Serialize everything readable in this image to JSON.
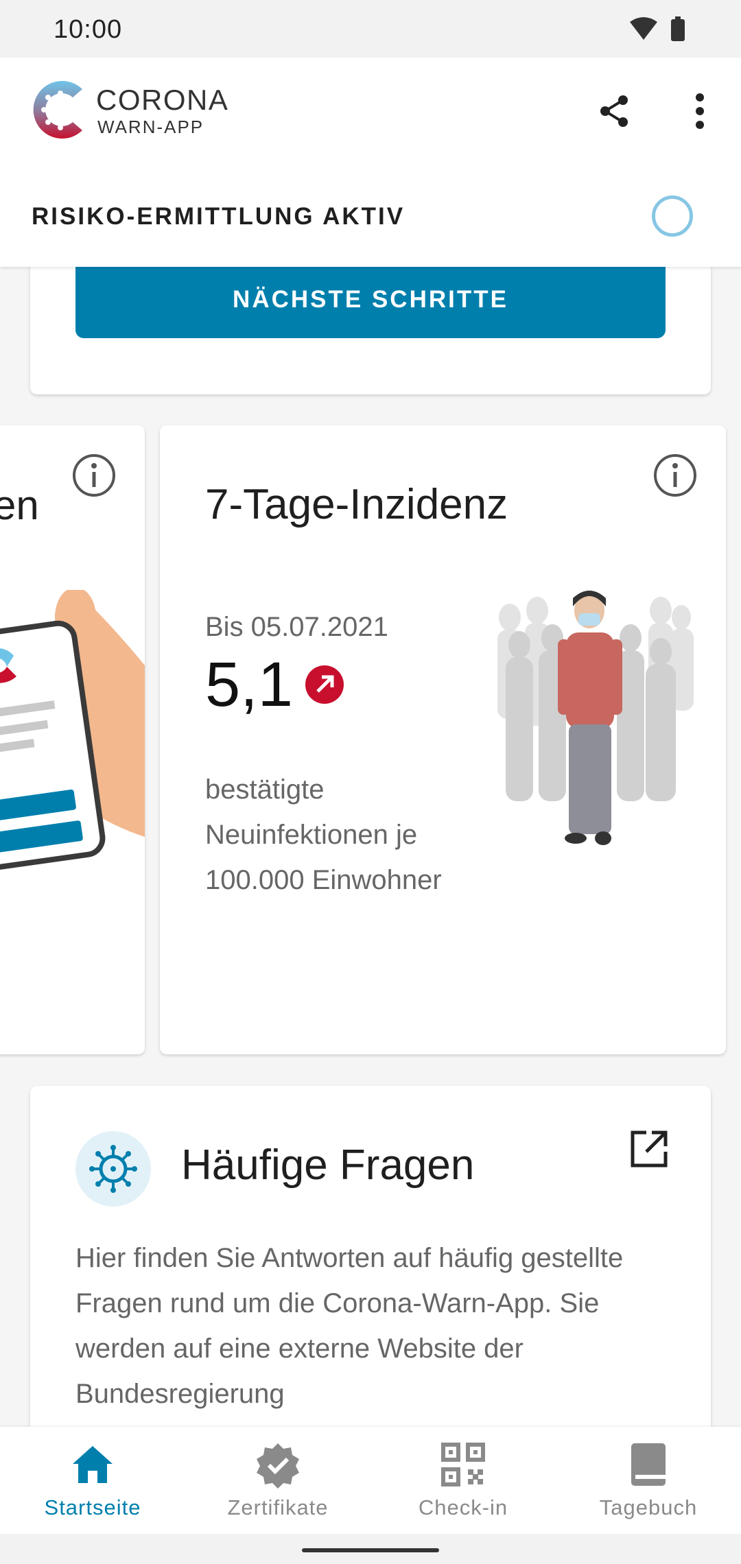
{
  "status_bar": {
    "time": "10:00"
  },
  "header": {
    "brand_main": "CORONA",
    "brand_sub": "WARN-APP",
    "risk_label": "RISIKO-ERMITTLUNG AKTIV"
  },
  "top_card": {
    "button_label": "NÄCHSTE SCHRITTE"
  },
  "left_card": {
    "partial_text": "en"
  },
  "incidence_card": {
    "title": "7-Tage-Inzidenz",
    "date": "Bis 05.07.2021",
    "value": "5,1",
    "trend": "increasing",
    "description": "bestätigte Neuinfektionen je 100.000 Einwohner"
  },
  "faq_card": {
    "title": "Häufige Fragen",
    "text": "Hier finden Sie Antworten auf häufig gestellte Fragen rund um die Corona-Warn-App. Sie werden auf eine externe Website der Bundesregierung"
  },
  "bottom_nav": [
    {
      "label": "Startseite",
      "icon": "home-icon",
      "active": true
    },
    {
      "label": "Zertifikate",
      "icon": "certificate-icon",
      "active": false
    },
    {
      "label": "Check-in",
      "icon": "qr-code-icon",
      "active": false
    },
    {
      "label": "Tagebuch",
      "icon": "diary-icon",
      "active": false
    }
  ],
  "colors": {
    "accent": "#007fad",
    "trend_red": "#c8102e",
    "spinner": "#86c6e4"
  }
}
